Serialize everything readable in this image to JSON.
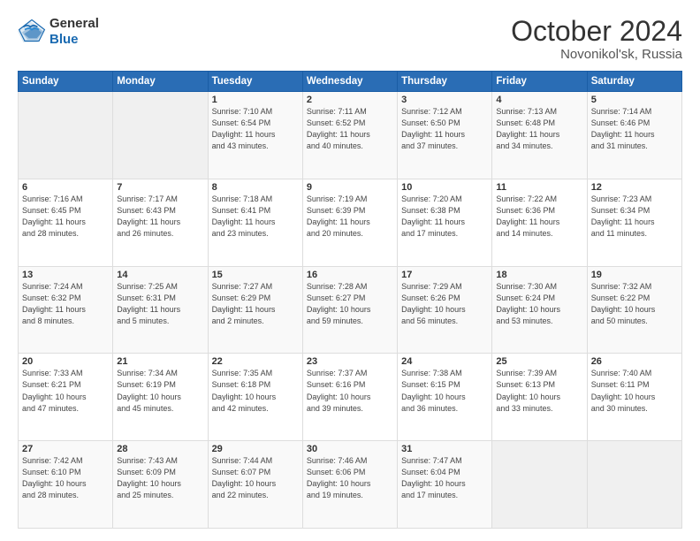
{
  "header": {
    "logo_line1": "General",
    "logo_line2": "Blue",
    "month": "October 2024",
    "location": "Novonikol'sk, Russia"
  },
  "weekdays": [
    "Sunday",
    "Monday",
    "Tuesday",
    "Wednesday",
    "Thursday",
    "Friday",
    "Saturday"
  ],
  "weeks": [
    [
      {
        "day": "",
        "info": ""
      },
      {
        "day": "",
        "info": ""
      },
      {
        "day": "1",
        "info": "Sunrise: 7:10 AM\nSunset: 6:54 PM\nDaylight: 11 hours\nand 43 minutes."
      },
      {
        "day": "2",
        "info": "Sunrise: 7:11 AM\nSunset: 6:52 PM\nDaylight: 11 hours\nand 40 minutes."
      },
      {
        "day": "3",
        "info": "Sunrise: 7:12 AM\nSunset: 6:50 PM\nDaylight: 11 hours\nand 37 minutes."
      },
      {
        "day": "4",
        "info": "Sunrise: 7:13 AM\nSunset: 6:48 PM\nDaylight: 11 hours\nand 34 minutes."
      },
      {
        "day": "5",
        "info": "Sunrise: 7:14 AM\nSunset: 6:46 PM\nDaylight: 11 hours\nand 31 minutes."
      }
    ],
    [
      {
        "day": "6",
        "info": "Sunrise: 7:16 AM\nSunset: 6:45 PM\nDaylight: 11 hours\nand 28 minutes."
      },
      {
        "day": "7",
        "info": "Sunrise: 7:17 AM\nSunset: 6:43 PM\nDaylight: 11 hours\nand 26 minutes."
      },
      {
        "day": "8",
        "info": "Sunrise: 7:18 AM\nSunset: 6:41 PM\nDaylight: 11 hours\nand 23 minutes."
      },
      {
        "day": "9",
        "info": "Sunrise: 7:19 AM\nSunset: 6:39 PM\nDaylight: 11 hours\nand 20 minutes."
      },
      {
        "day": "10",
        "info": "Sunrise: 7:20 AM\nSunset: 6:38 PM\nDaylight: 11 hours\nand 17 minutes."
      },
      {
        "day": "11",
        "info": "Sunrise: 7:22 AM\nSunset: 6:36 PM\nDaylight: 11 hours\nand 14 minutes."
      },
      {
        "day": "12",
        "info": "Sunrise: 7:23 AM\nSunset: 6:34 PM\nDaylight: 11 hours\nand 11 minutes."
      }
    ],
    [
      {
        "day": "13",
        "info": "Sunrise: 7:24 AM\nSunset: 6:32 PM\nDaylight: 11 hours\nand 8 minutes."
      },
      {
        "day": "14",
        "info": "Sunrise: 7:25 AM\nSunset: 6:31 PM\nDaylight: 11 hours\nand 5 minutes."
      },
      {
        "day": "15",
        "info": "Sunrise: 7:27 AM\nSunset: 6:29 PM\nDaylight: 11 hours\nand 2 minutes."
      },
      {
        "day": "16",
        "info": "Sunrise: 7:28 AM\nSunset: 6:27 PM\nDaylight: 10 hours\nand 59 minutes."
      },
      {
        "day": "17",
        "info": "Sunrise: 7:29 AM\nSunset: 6:26 PM\nDaylight: 10 hours\nand 56 minutes."
      },
      {
        "day": "18",
        "info": "Sunrise: 7:30 AM\nSunset: 6:24 PM\nDaylight: 10 hours\nand 53 minutes."
      },
      {
        "day": "19",
        "info": "Sunrise: 7:32 AM\nSunset: 6:22 PM\nDaylight: 10 hours\nand 50 minutes."
      }
    ],
    [
      {
        "day": "20",
        "info": "Sunrise: 7:33 AM\nSunset: 6:21 PM\nDaylight: 10 hours\nand 47 minutes."
      },
      {
        "day": "21",
        "info": "Sunrise: 7:34 AM\nSunset: 6:19 PM\nDaylight: 10 hours\nand 45 minutes."
      },
      {
        "day": "22",
        "info": "Sunrise: 7:35 AM\nSunset: 6:18 PM\nDaylight: 10 hours\nand 42 minutes."
      },
      {
        "day": "23",
        "info": "Sunrise: 7:37 AM\nSunset: 6:16 PM\nDaylight: 10 hours\nand 39 minutes."
      },
      {
        "day": "24",
        "info": "Sunrise: 7:38 AM\nSunset: 6:15 PM\nDaylight: 10 hours\nand 36 minutes."
      },
      {
        "day": "25",
        "info": "Sunrise: 7:39 AM\nSunset: 6:13 PM\nDaylight: 10 hours\nand 33 minutes."
      },
      {
        "day": "26",
        "info": "Sunrise: 7:40 AM\nSunset: 6:11 PM\nDaylight: 10 hours\nand 30 minutes."
      }
    ],
    [
      {
        "day": "27",
        "info": "Sunrise: 7:42 AM\nSunset: 6:10 PM\nDaylight: 10 hours\nand 28 minutes."
      },
      {
        "day": "28",
        "info": "Sunrise: 7:43 AM\nSunset: 6:09 PM\nDaylight: 10 hours\nand 25 minutes."
      },
      {
        "day": "29",
        "info": "Sunrise: 7:44 AM\nSunset: 6:07 PM\nDaylight: 10 hours\nand 22 minutes."
      },
      {
        "day": "30",
        "info": "Sunrise: 7:46 AM\nSunset: 6:06 PM\nDaylight: 10 hours\nand 19 minutes."
      },
      {
        "day": "31",
        "info": "Sunrise: 7:47 AM\nSunset: 6:04 PM\nDaylight: 10 hours\nand 17 minutes."
      },
      {
        "day": "",
        "info": ""
      },
      {
        "day": "",
        "info": ""
      }
    ]
  ]
}
